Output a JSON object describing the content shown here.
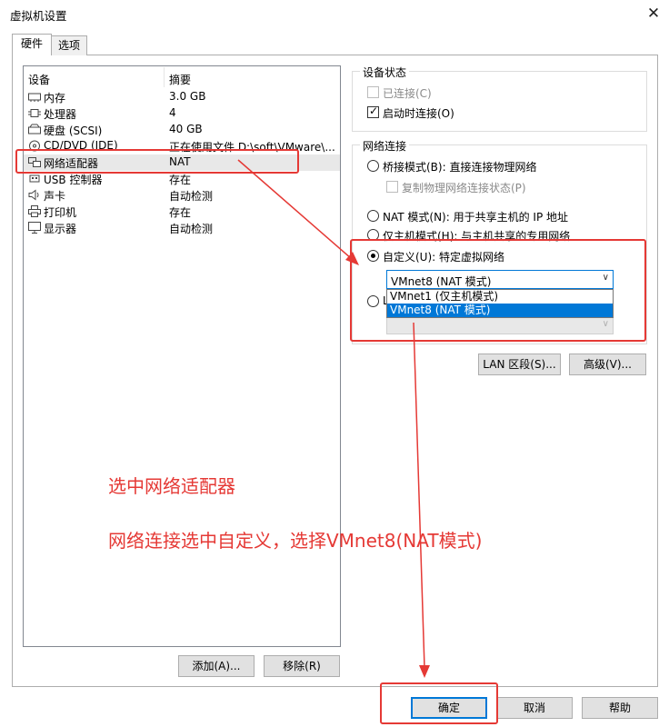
{
  "window": {
    "title": "虚拟机设置",
    "close_glyph": "✕"
  },
  "tabs": [
    {
      "label": "硬件"
    },
    {
      "label": "选项"
    }
  ],
  "device_list": {
    "headers": {
      "device": "设备",
      "summary": "摘要"
    },
    "items": [
      {
        "name": "内存",
        "summary": "3.0 GB",
        "icon": "memory-icon"
      },
      {
        "name": "处理器",
        "summary": "4",
        "icon": "cpu-icon"
      },
      {
        "name": "硬盘 (SCSI)",
        "summary": "40 GB",
        "icon": "hard-disk-icon"
      },
      {
        "name": "CD/DVD (IDE)",
        "summary": "正在使用文件 D:\\soft\\VMware\\...",
        "icon": "cd-dvd-icon"
      },
      {
        "name": "网络适配器",
        "summary": "NAT",
        "icon": "network-adapter-icon"
      },
      {
        "name": "USB 控制器",
        "summary": "存在",
        "icon": "usb-icon"
      },
      {
        "name": "声卡",
        "summary": "自动检测",
        "icon": "speaker-icon"
      },
      {
        "name": "打印机",
        "summary": "存在",
        "icon": "printer-icon"
      },
      {
        "name": "显示器",
        "summary": "自动检测",
        "icon": "monitor-icon"
      }
    ],
    "selected": "网络适配器"
  },
  "device_status": {
    "title": "设备状态",
    "connected": {
      "label": "已连接(C)",
      "checked": false,
      "enabled": false
    },
    "connect_at_power_on": {
      "label": "启动时连接(O)",
      "checked": true,
      "enabled": true
    }
  },
  "network_connection": {
    "title": "网络连接",
    "bridged": "桥接模式(B): 直接连接物理网络",
    "replicate": "复制物理网络连接状态(P)",
    "nat": "NAT 模式(N): 用于共享主机的 IP 地址",
    "host_only": "仅主机模式(H): 与主机共享的专用网络",
    "custom": "自定义(U): 特定虚拟网络",
    "lan_segment_partial": "L",
    "selected": "custom",
    "custom_select_value": "VMnet8 (NAT 模式)",
    "dropdown_options": [
      "VMnet1 (仅主机模式)",
      "VMnet8 (NAT 模式)"
    ],
    "dropdown_selected": "VMnet8 (NAT 模式)"
  },
  "buttons": {
    "lan_segments": "LAN 区段(S)...",
    "advanced": "高级(V)...",
    "add": "添加(A)...",
    "remove": "移除(R)",
    "ok": "确定",
    "cancel": "取消",
    "help": "帮助"
  },
  "annotations": {
    "line1": "选中网络适配器",
    "line2": "网络连接选中自定义，选择VMnet8(NAT模式)",
    "color": "#e53935"
  }
}
